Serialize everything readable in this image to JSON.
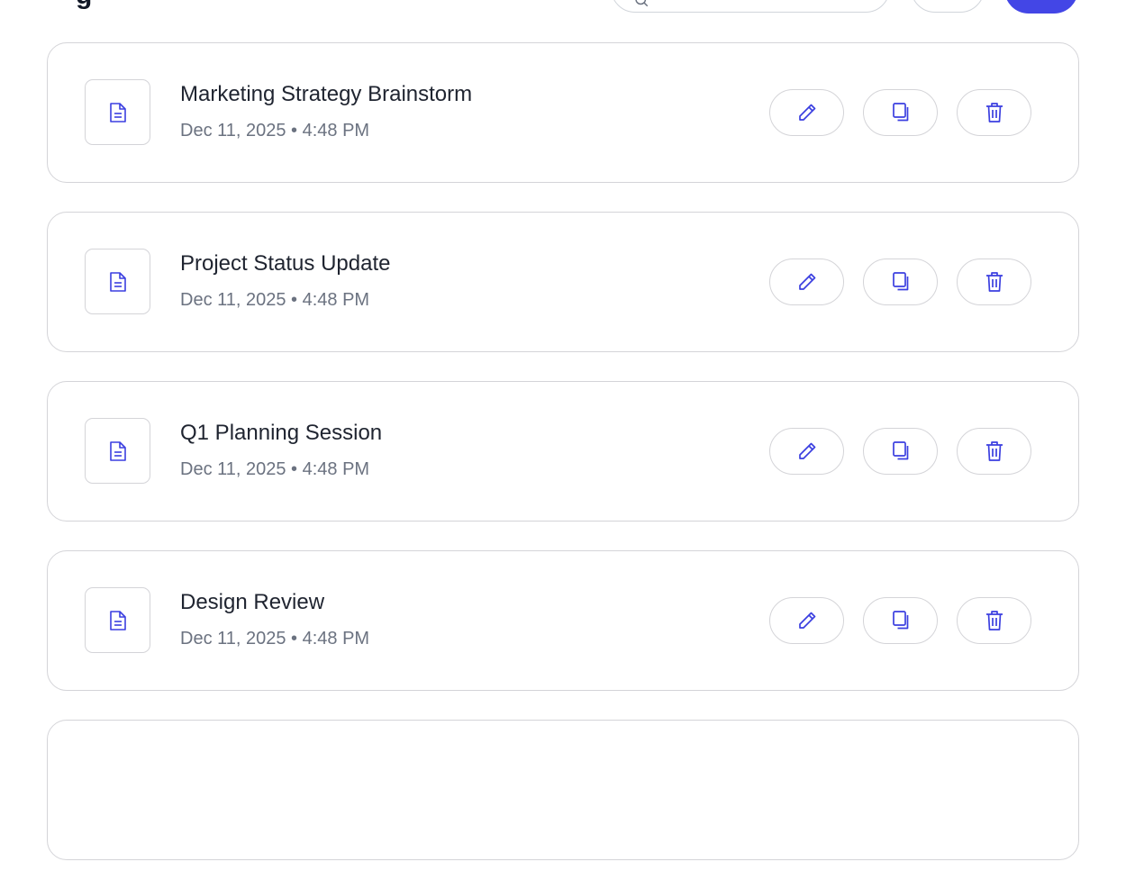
{
  "header": {
    "title_partial": "g"
  },
  "icons": {
    "document": "document-icon",
    "edit": "pencil-icon",
    "duplicate": "copy-icon",
    "delete": "trash-icon",
    "search": "search-icon"
  },
  "colors": {
    "accent": "#4346e6",
    "icon": "#3b3fe0",
    "border": "#d4d4d8",
    "title": "#1f2430",
    "subtext": "#6b7280"
  },
  "items": [
    {
      "title": "Marketing Strategy Brainstorm",
      "date": "Dec 11, 2025 • 4:48 PM"
    },
    {
      "title": "Project Status Update",
      "date": "Dec 11, 2025 • 4:48 PM"
    },
    {
      "title": "Q1 Planning Session",
      "date": "Dec 11, 2025 • 4:48 PM"
    },
    {
      "title": "Design Review",
      "date": "Dec 11, 2025 • 4:48 PM"
    },
    {
      "title": "",
      "date": ""
    }
  ]
}
